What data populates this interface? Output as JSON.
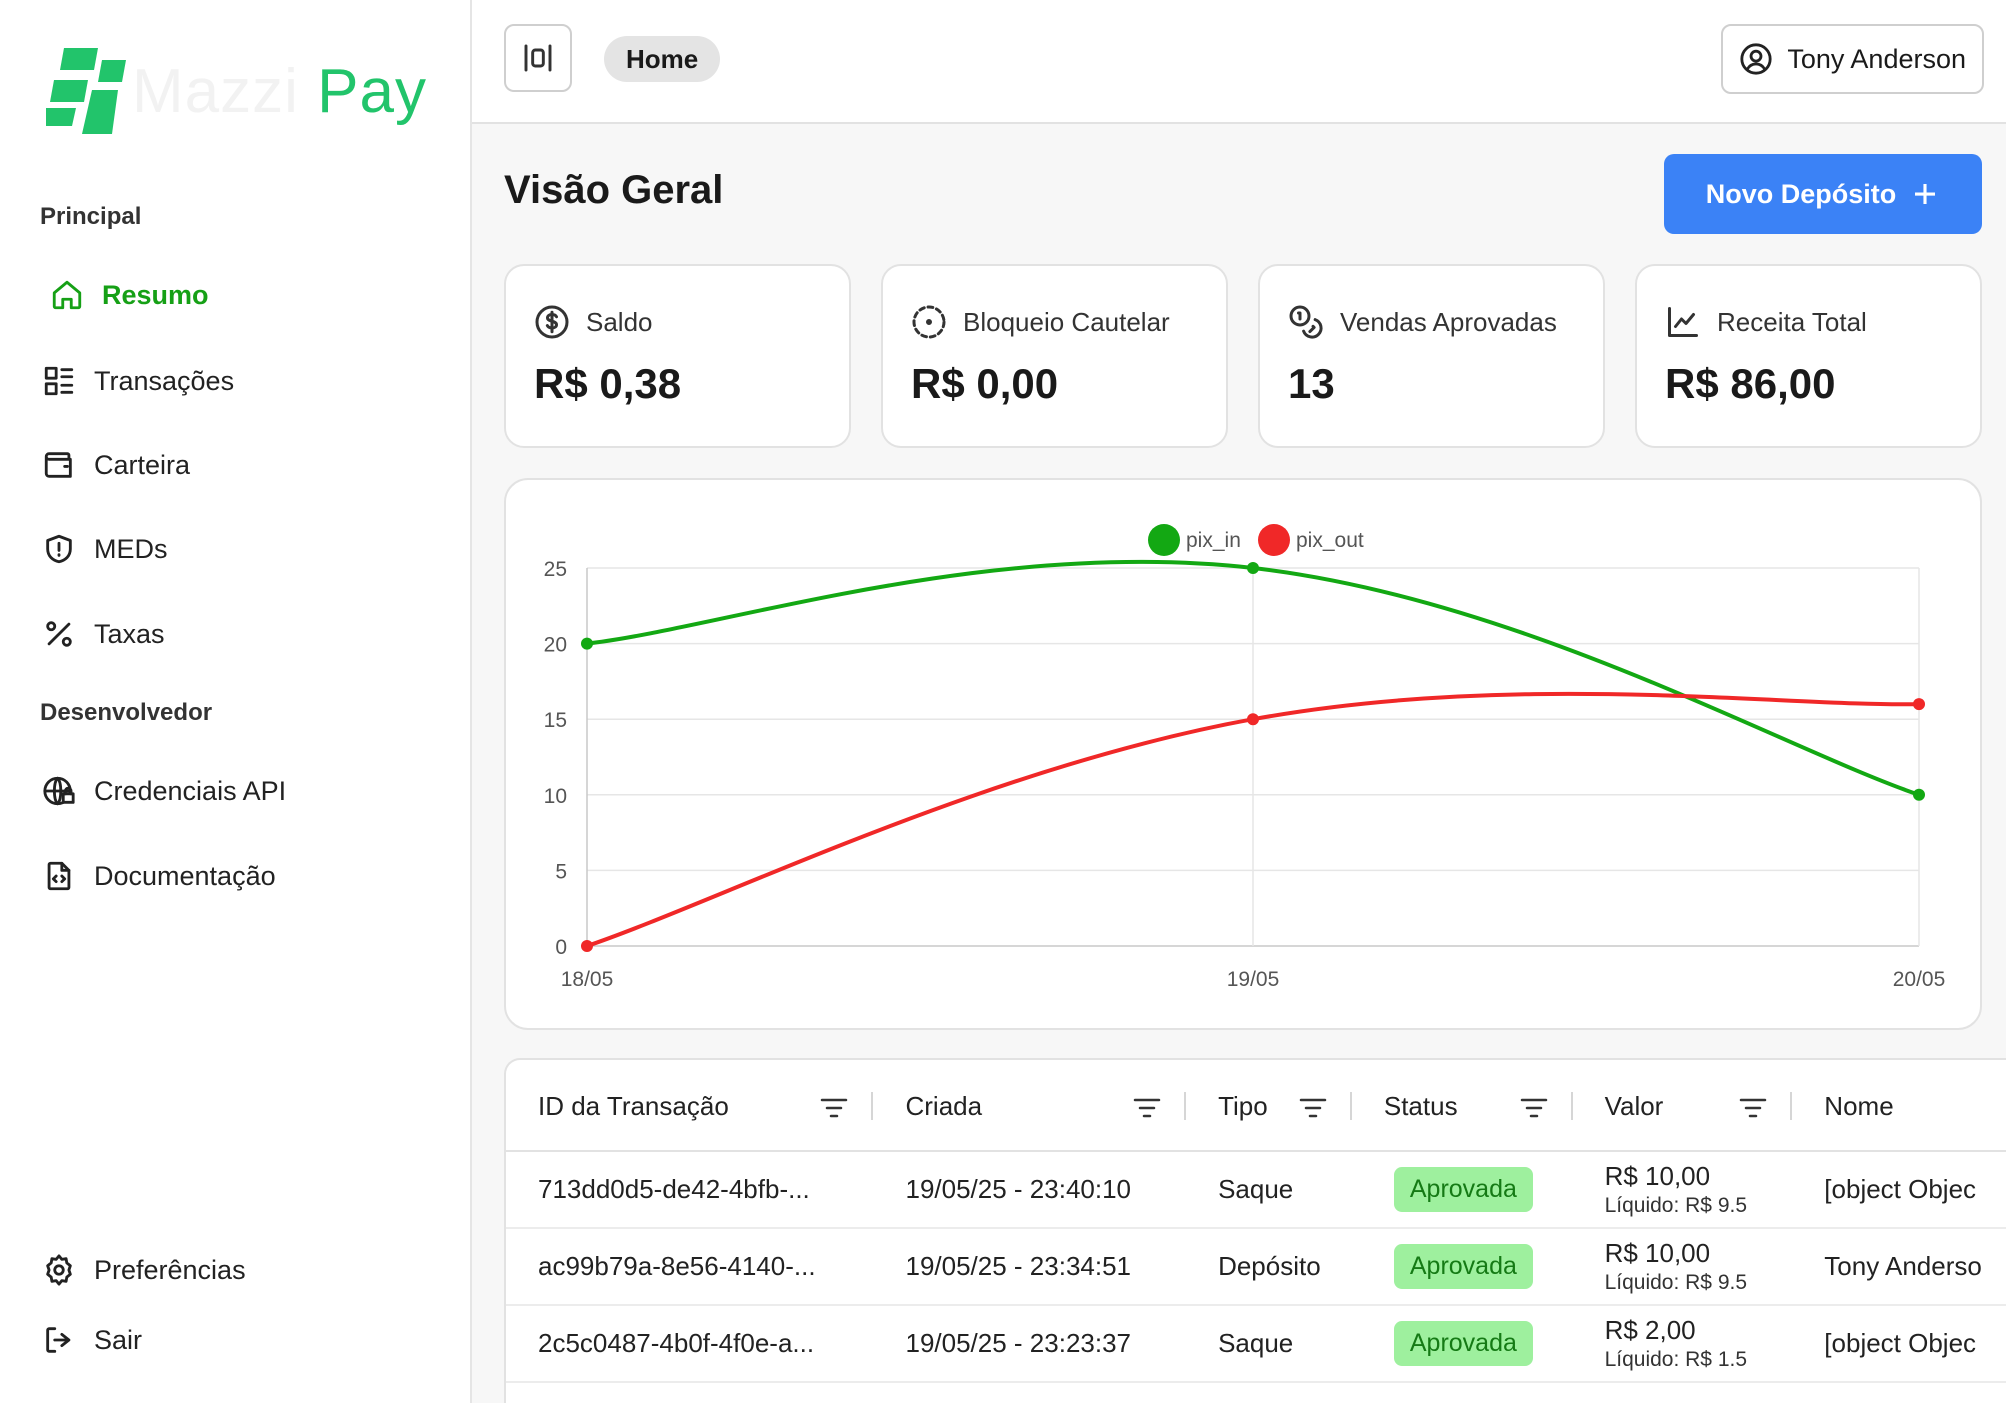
{
  "brand": {
    "name_part1": "Mazzi",
    "name_part2": "Pay",
    "accent": "#22c46b"
  },
  "sidebar": {
    "section_main": "Principal",
    "section_dev": "Desenvolvedor",
    "items": [
      {
        "label": "Resumo",
        "icon": "home-icon"
      },
      {
        "label": "Transações",
        "icon": "list-icon"
      },
      {
        "label": "Carteira",
        "icon": "wallet-icon"
      },
      {
        "label": "MEDs",
        "icon": "shield-icon"
      },
      {
        "label": "Taxas",
        "icon": "percent-icon"
      },
      {
        "label": "Credenciais API",
        "icon": "globe-lock-icon"
      },
      {
        "label": "Documentação",
        "icon": "file-code-icon"
      },
      {
        "label": "Preferências",
        "icon": "gear-icon"
      },
      {
        "label": "Sair",
        "icon": "logout-icon"
      }
    ]
  },
  "header": {
    "breadcrumb": "Home",
    "user_name": "Tony Anderson"
  },
  "main": {
    "title": "Visão Geral",
    "deposit_button": "Novo Depósito",
    "cards": [
      {
        "label": "Saldo",
        "value": "R$ 0,38",
        "icon": "dollar-circle-icon"
      },
      {
        "label": "Bloqueio Cautelar",
        "value": "R$ 0,00",
        "icon": "dashed-circle-icon"
      },
      {
        "label": "Vendas Aprovadas",
        "value": "13",
        "icon": "coins-icon"
      },
      {
        "label": "Receita Total",
        "value": "R$ 86,00",
        "icon": "line-chart-icon"
      }
    ]
  },
  "chart_data": {
    "type": "line",
    "x": [
      "18/05",
      "19/05",
      "20/05"
    ],
    "series": [
      {
        "name": "pix_in",
        "values": [
          20,
          25,
          10
        ],
        "color": "#13a813"
      },
      {
        "name": "pix_out",
        "values": [
          0,
          15,
          16
        ],
        "color": "#f02828"
      }
    ],
    "ylim": [
      0,
      25
    ],
    "yticks": [
      "0",
      "5",
      "10",
      "15",
      "20",
      "25"
    ],
    "legend": "top-center",
    "grid": true
  },
  "table": {
    "columns": [
      "ID da Transação",
      "Criada",
      "Tipo",
      "Status",
      "Valor",
      "Nome"
    ],
    "rows": [
      {
        "id": "713dd0d5-de42-4bfb-...",
        "created": "19/05/25 - 23:40:10",
        "type": "Saque",
        "status": "Aprovada",
        "value": "R$ 10,00",
        "net": "Líquido: R$ 9.5",
        "name": "[object Objec"
      },
      {
        "id": "ac99b79a-8e56-4140-...",
        "created": "19/05/25 - 23:34:51",
        "type": "Depósito",
        "status": "Aprovada",
        "value": "R$ 10,00",
        "net": "Líquido: R$ 9.5",
        "name": "Tony Anderso"
      },
      {
        "id": "2c5c0487-4b0f-4f0e-a...",
        "created": "19/05/25 - 23:23:37",
        "type": "Saque",
        "status": "Aprovada",
        "value": "R$ 2,00",
        "net": "Líquido: R$ 1.5",
        "name": "[object Objec"
      }
    ]
  }
}
